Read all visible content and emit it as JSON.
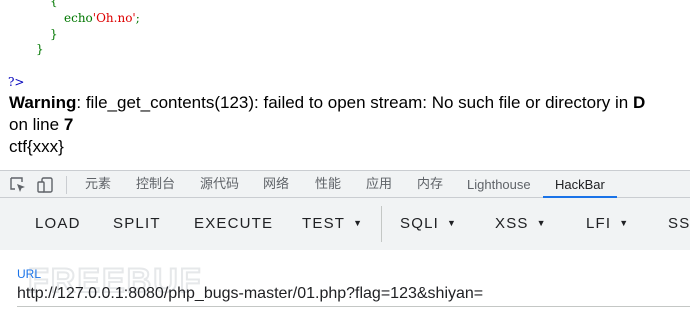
{
  "source": {
    "lines": [
      "{",
      "echo'Oh.no';",
      "}",
      "}"
    ],
    "php_close": "?>"
  },
  "output": {
    "warning_label": "Warning",
    "warning_text": ": file_get_contents(123): failed to open stream: No such file or directory in ",
    "warning_cut": "D",
    "line_prefix": "on line ",
    "line_number": "7",
    "flag": "ctf{xxx}"
  },
  "devtools": {
    "tabs": [
      "元素",
      "控制台",
      "源代码",
      "网络",
      "性能",
      "应用",
      "内存",
      "Lighthouse",
      "HackBar"
    ],
    "active_tab": "HackBar"
  },
  "hackbar": {
    "buttons": [
      "LOAD",
      "SPLIT",
      "EXECUTE",
      "TEST",
      "SQLI",
      "XSS",
      "LFI",
      "SS"
    ],
    "url_label": "URL",
    "url_value": "http://127.0.0.1:8080/php_bugs-master/01.php?flag=123&shiyan=",
    "watermark": "FREEBUF"
  },
  "colors": {
    "keyword": "#007700",
    "string": "#DD0000",
    "php_tag": "#0000BB",
    "accent": "#1a73e8"
  }
}
